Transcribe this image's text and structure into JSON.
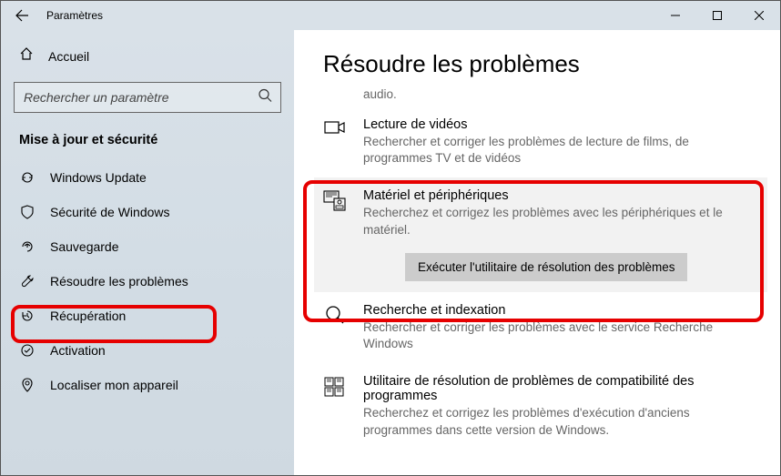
{
  "titlebar": {
    "title": "Paramètres"
  },
  "sidebar": {
    "home": "Accueil",
    "search_placeholder": "Rechercher un paramètre",
    "section": "Mise à jour et sécurité",
    "items": [
      {
        "label": "Windows Update"
      },
      {
        "label": "Sécurité de Windows"
      },
      {
        "label": "Sauvegarde"
      },
      {
        "label": "Résoudre les problèmes"
      },
      {
        "label": "Récupération"
      },
      {
        "label": "Activation"
      },
      {
        "label": "Localiser mon appareil"
      }
    ]
  },
  "main": {
    "title": "Résoudre les problèmes",
    "orphan_tail": "audio.",
    "items": [
      {
        "title": "Lecture de vidéos",
        "desc": "Rechercher et corriger les problèmes de lecture de films, de programmes TV et de vidéos"
      },
      {
        "title": "Matériel et périphériques",
        "desc": "Recherchez et corrigez les problèmes avec les périphériques et le matériel.",
        "run_label": "Exécuter l'utilitaire de résolution des problèmes"
      },
      {
        "title": "Recherche et indexation",
        "desc": "Rechercher et corriger les problèmes avec le service Recherche Windows"
      },
      {
        "title": "Utilitaire de résolution de problèmes de compatibilité des programmes",
        "desc": "Recherchez et corrigez les problèmes d'exécution d'anciens programmes dans cette version de Windows."
      }
    ]
  }
}
